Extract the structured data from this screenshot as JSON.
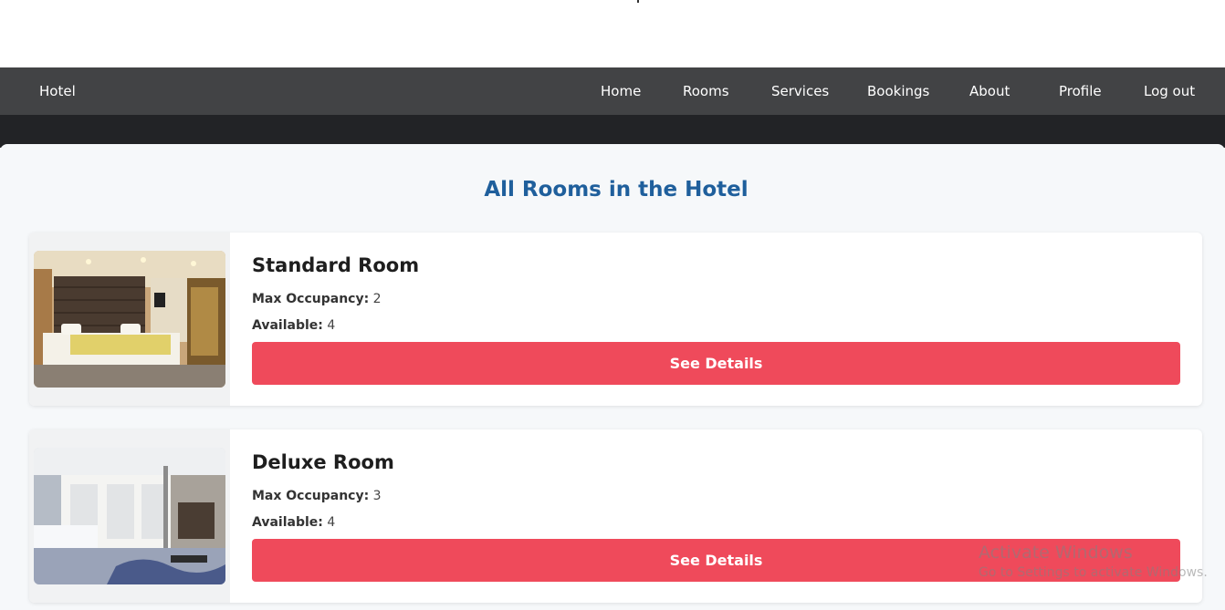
{
  "navbar": {
    "brand": "Hotel",
    "items": [
      {
        "label": "Home"
      },
      {
        "label": "Rooms"
      },
      {
        "label": "Services"
      },
      {
        "label": "Bookings"
      },
      {
        "label": "About"
      },
      {
        "label": "Profile"
      },
      {
        "label": "Log out"
      }
    ],
    "background": "#424345"
  },
  "page": {
    "title": "All Rooms in the Hotel",
    "title_color": "#1f5f9c"
  },
  "rooms": [
    {
      "name": "Standard Room",
      "occupancy_label": "Max Occupancy:",
      "occupancy": "2",
      "available_label": "Available:",
      "available": "4",
      "button_label": "See Details"
    },
    {
      "name": "Deluxe Room",
      "occupancy_label": "Max Occupancy:",
      "occupancy": "3",
      "available_label": "Available:",
      "available": "4",
      "button_label": "See Details"
    }
  ],
  "button_color": "#ef4a5b",
  "watermark": {
    "title": "Activate Windows",
    "subtitle": "Go to Settings to activate Windows."
  }
}
